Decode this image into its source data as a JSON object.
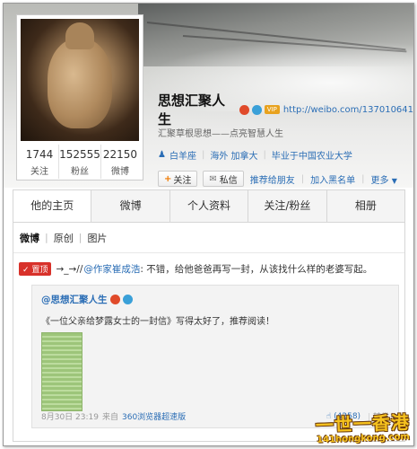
{
  "colors": {
    "link": "#2a6db5",
    "pinned_bg": "#d8312a",
    "vip_bg": "#e8a21e",
    "watermark": "#f6c21e"
  },
  "profile": {
    "name": "思想汇聚人生",
    "vip_label": "VIP",
    "url": "http://weibo.com/137010641",
    "motto": "汇聚草根思想——点亮智慧人生",
    "tags": [
      "白羊座",
      "海外 加拿大",
      "毕业于中国农业大学"
    ],
    "stats": [
      {
        "num": "1744",
        "label": "关注"
      },
      {
        "num": "152555",
        "label": "粉丝"
      },
      {
        "num": "22150",
        "label": "微博"
      }
    ],
    "actions": {
      "follow": "关注",
      "message": "私信",
      "recommend": "推荐给朋友",
      "blacklist": "加入黑名单",
      "more": "更多"
    }
  },
  "tabs": [
    "他的主页",
    "微博",
    "个人资料",
    "关注/粉丝",
    "相册"
  ],
  "subtabs": [
    "微博",
    "原创",
    "图片"
  ],
  "post": {
    "pinned_label": "置顶",
    "prefix": "→_→//",
    "mention": "@作家崔成浩",
    "text": ": 不错，给他爸爸再写一封，从该找什么样的老婆写起。",
    "repost": {
      "author": "@思想汇聚人生",
      "text": "《一位父亲给梦露女士的一封信》写得太好了，推荐阅读！",
      "date": "8月30日 23:19",
      "source_prefix": "来自",
      "source": "360浏览器超速版",
      "likes": "(4258)",
      "forward": "转发"
    }
  },
  "watermark": {
    "big": "一世一香港",
    "small": "141hongkong.com"
  }
}
